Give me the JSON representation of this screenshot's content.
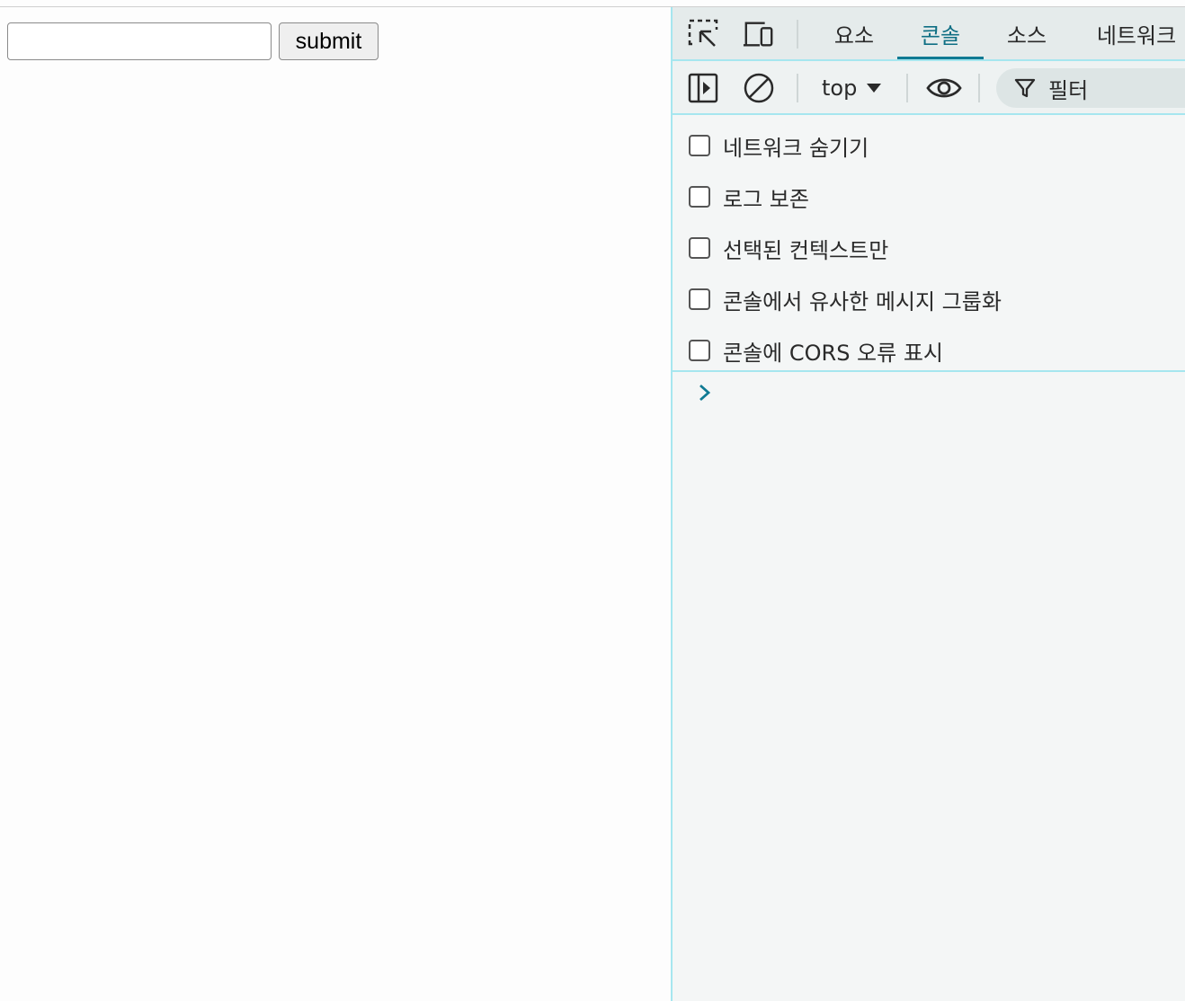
{
  "page": {
    "text_input_value": "",
    "submit_label": "submit"
  },
  "devtools": {
    "tool_icons": [
      "inspect-element-icon",
      "device-toolbar-icon"
    ],
    "tabs": [
      {
        "label": "요소",
        "active": false
      },
      {
        "label": "콘솔",
        "active": true
      },
      {
        "label": "소스",
        "active": false
      },
      {
        "label": "네트워크",
        "active": false
      }
    ],
    "toolbar": {
      "sidebar_icon": "sidebar-toggle-icon",
      "clear_icon": "clear-console-icon",
      "context": "top",
      "live_expression_icon": "eye-icon",
      "filter_icon": "funnel-icon",
      "filter_placeholder": "필터"
    },
    "settings": [
      {
        "label": "네트워크 숨기기",
        "checked": false
      },
      {
        "label": "로그 보존",
        "checked": false
      },
      {
        "label": "선택된 컨텍스트만",
        "checked": false
      },
      {
        "label": "콘솔에서 유사한 메시지 그룹화",
        "checked": false
      },
      {
        "label": "콘솔에 CORS 오류 표시",
        "checked": false
      }
    ],
    "prompt_icon": "chevron-right-icon"
  },
  "colors": {
    "accent": "#0f7a93",
    "border": "#a6e6ef"
  }
}
